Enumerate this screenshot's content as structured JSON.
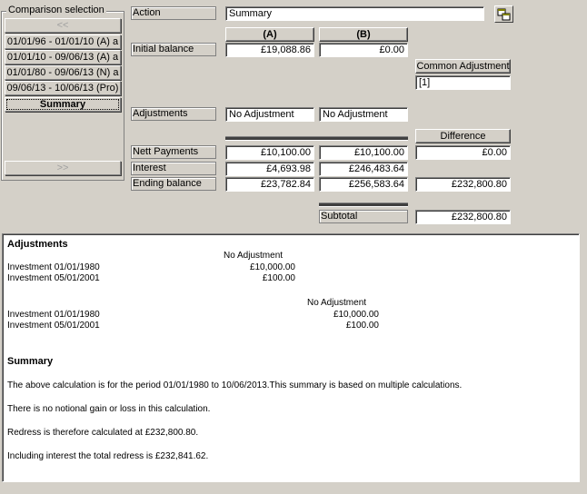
{
  "comparison": {
    "group_label": "Comparison selection",
    "prev_label": "<<",
    "next_label": ">>",
    "items": [
      {
        "label": "01/01/96 - 01/01/10 (A) a"
      },
      {
        "label": "01/01/10 - 09/06/13 (A) a"
      },
      {
        "label": "01/01/80 - 09/06/13 (N) a"
      },
      {
        "label": "09/06/13 - 10/06/13 (Pro)"
      },
      {
        "label": "Summary",
        "selected": true
      }
    ]
  },
  "form": {
    "action_label": "Action",
    "action_value": "Summary",
    "col_a": "(A)",
    "col_b": "(B)",
    "initial_balance_label": "Initial balance",
    "initial_a": "£19,088.86",
    "initial_b": "£0.00",
    "common_adjustment_label": "Common Adjustment",
    "common_adjustment_value": "[1]",
    "adjustments_label": "Adjustments",
    "adjustments_a": "No Adjustment",
    "adjustments_b": "No Adjustment",
    "difference_label": "Difference",
    "nett_payments_label": "Nett Payments",
    "nett_a": "£10,100.00",
    "nett_b": "£10,100.00",
    "nett_diff": "£0.00",
    "interest_label": "Interest",
    "interest_a": "£4,693.98",
    "interest_b": "£246,483.64",
    "ending_label": "Ending balance",
    "ending_a": "£23,782.84",
    "ending_b": "£256,583.64",
    "ending_diff": "£232,800.80",
    "subtotal_label": "Subtotal",
    "subtotal_value": "£232,800.80"
  },
  "report": {
    "adjustments_heading": "Adjustments",
    "block1_title": "No Adjustment",
    "block1_rows": [
      {
        "label": "Investment 01/01/1980",
        "value": "£10,000.00"
      },
      {
        "label": "Investment 05/01/2001",
        "value": "£100.00"
      }
    ],
    "block2_title": "No Adjustment",
    "block2_rows": [
      {
        "label": "Investment 01/01/1980",
        "value": "£10,000.00"
      },
      {
        "label": "Investment 05/01/2001",
        "value": "£100.00"
      }
    ],
    "summary_heading": "Summary",
    "summary_lines": [
      "The above calculation is for the period 01/01/1980 to 10/06/2013.This summary is based on multiple calculations.",
      "There is no notional gain or loss in this calculation.",
      "Redress is therefore calculated at £232,800.80.",
      "Including interest the total redress is £232,841.62."
    ]
  },
  "colors": {
    "window_bg": "#d4d0c8",
    "field_bg": "#ffffff",
    "separator": "#404040"
  },
  "icons": {
    "toolbar_button": "copy-windows-icon"
  }
}
